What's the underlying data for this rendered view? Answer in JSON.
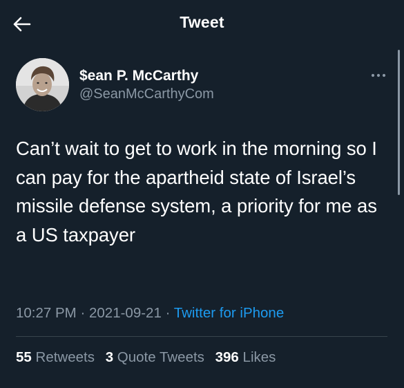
{
  "header": {
    "title": "Tweet",
    "back_icon": "arrow-left-icon"
  },
  "tweet": {
    "author": {
      "display_name": "$ean P. McCarthy",
      "handle": "@SeanMcCarthyCom"
    },
    "more_icon": "more-horizontal-icon",
    "text": "Can’t wait to get to work in the morning so I can pay for the apartheid state of Israel’s missile defense system, a priority for me as a US taxpayer",
    "time": "10:27 PM",
    "separator": "·",
    "date": "2021-09-21",
    "source": "Twitter for iPhone"
  },
  "stats": {
    "retweets": {
      "count": "55",
      "label": "Retweets"
    },
    "quotes": {
      "count": "3",
      "label": "Quote Tweets"
    },
    "likes": {
      "count": "396",
      "label": "Likes"
    }
  },
  "colors": {
    "background": "#15202b",
    "text": "#ffffff",
    "secondary": "#8b98a5",
    "link": "#1d9bf0",
    "divider": "#38444d"
  }
}
